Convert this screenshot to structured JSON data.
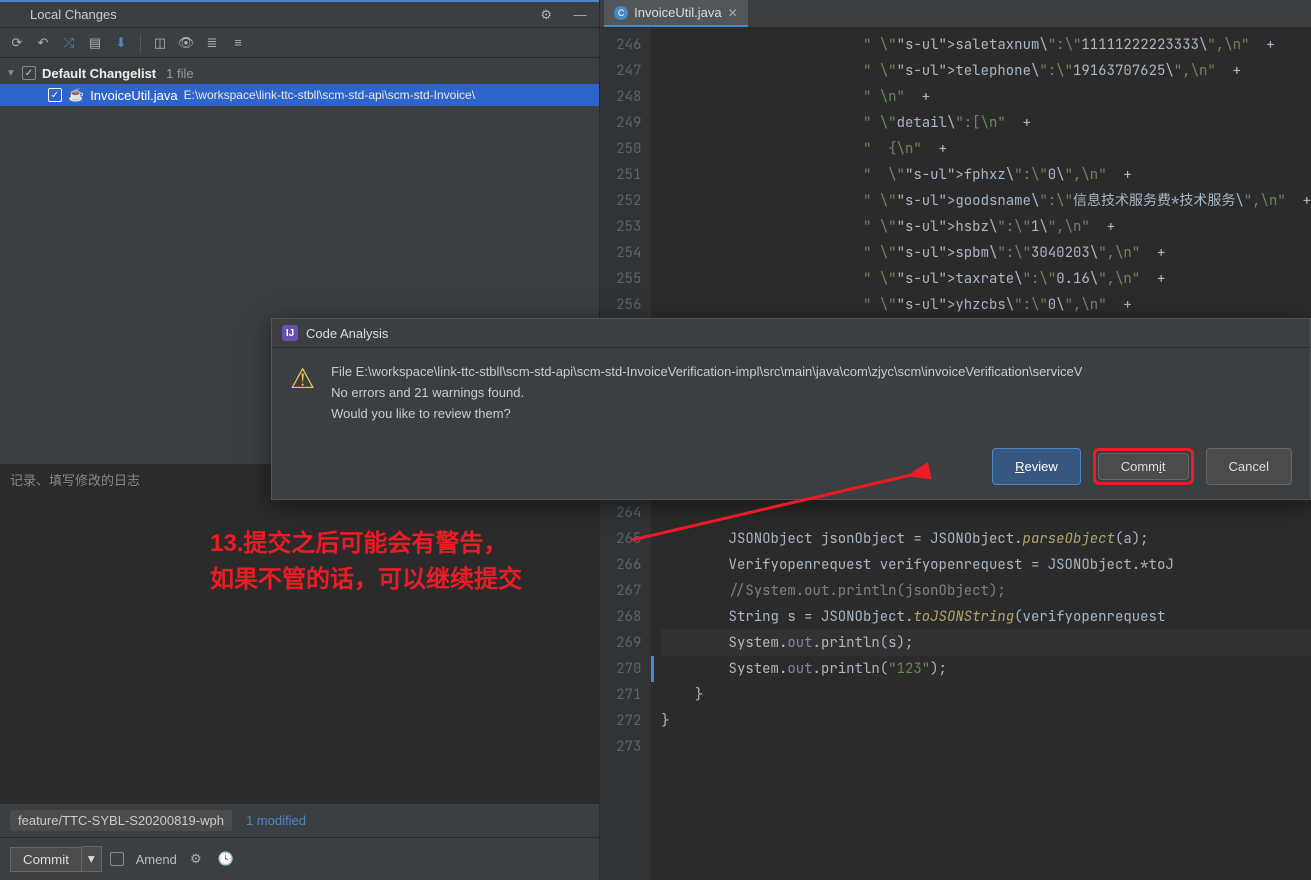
{
  "localChanges": {
    "title": "Local Changes",
    "changelist": "Default Changelist",
    "file_count_hint": "1 file",
    "file_name": "InvoiceUtil.java",
    "file_path": "E:\\workspace\\link-ttc-stbll\\scm-std-api\\scm-std-Invoice\\"
  },
  "commit": {
    "placeholder": "记录、填写修改的日志",
    "branch": "feature/TTC-SYBL-S20200819-wph",
    "modified": "1 modified",
    "commit_label": "Commit",
    "amend_label": "Amend"
  },
  "editorTab": {
    "filename": "InvoiceUtil.java"
  },
  "code": {
    "first_line_no": 246,
    "lines": [
      {
        "n": 246,
        "c": "                        \" \\\"<u>saletaxnum</u>\\\":\\\"11111222223333\\\",\\n\"  +"
      },
      {
        "n": 247,
        "c": "                        \" \\\"<u>telephone</u>\\\":\\\"19163707625\\\",\\n\"  +"
      },
      {
        "n": 248,
        "c": "                        \" \\n\"  +"
      },
      {
        "n": 249,
        "c": "                        \" \\\"detail\\\":[\\n\"  +"
      },
      {
        "n": 250,
        "c": "                        \"  {\\n\"  +"
      },
      {
        "n": 251,
        "c": "                        \"  \\\"<u>fphxz</u>\\\":\\\"0\\\",\\n\"  +"
      },
      {
        "n": 252,
        "c": "                        \" \\\"<u>goodsname</u>\\\":\\\"信息技术服务费*技术服务\\\",\\n\"  +"
      },
      {
        "n": 253,
        "c": "                        \" \\\"<u>hsbz</u>\\\":\\\"1\\\",\\n\"  +"
      },
      {
        "n": 254,
        "c": "                        \" \\\"<u>spbm</u>\\\":\\\"3040203\\\",\\n\"  +"
      },
      {
        "n": 255,
        "c": "                        \" \\\"<u>taxrate</u>\\\":\\\"0.16\\\",\\n\"  +"
      },
      {
        "n": 256,
        "c": "                        \" \\\"<u>yhzcbs</u>\\\":\\\"0\\\",\\n\"  +"
      }
    ],
    "after_dialog": [
      {
        "n": 264,
        "c": ""
      },
      {
        "n": 265,
        "c": "        JSONObject jsonObject = JSONObject.*parseObject*(a);"
      },
      {
        "n": 266,
        "c": "        Verifyopenrequest verifyopenrequest = JSONObject.*toJ"
      },
      {
        "n": 267,
        "c": "        //System.out.println(jsonObject);"
      },
      {
        "n": 268,
        "c": "        String s = JSONObject.*toJSONString*(verifyopenrequest"
      },
      {
        "n": 269,
        "c": "        System.~out~.println(s);"
      },
      {
        "n": 270,
        "c": "        System.~out~.println(\"123\");"
      },
      {
        "n": 271,
        "c": "    }"
      },
      {
        "n": 272,
        "c": "}"
      },
      {
        "n": 273,
        "c": ""
      }
    ]
  },
  "dialog": {
    "title": "Code Analysis",
    "line1": "File E:\\workspace\\link-ttc-stbll\\scm-std-api\\scm-std-InvoiceVerification-impl\\src\\main\\java\\com\\zjyc\\scm\\invoiceVerification\\serviceV",
    "line2": "No errors and 21 warnings found.",
    "line3": "Would you like to review them?",
    "btn_review": "Review",
    "btn_commit": "Commit",
    "btn_cancel": "Cancel"
  },
  "annotation": {
    "text1": "13.提交之后可能会有警告，",
    "text2": "如果不管的话，可以继续提交"
  }
}
